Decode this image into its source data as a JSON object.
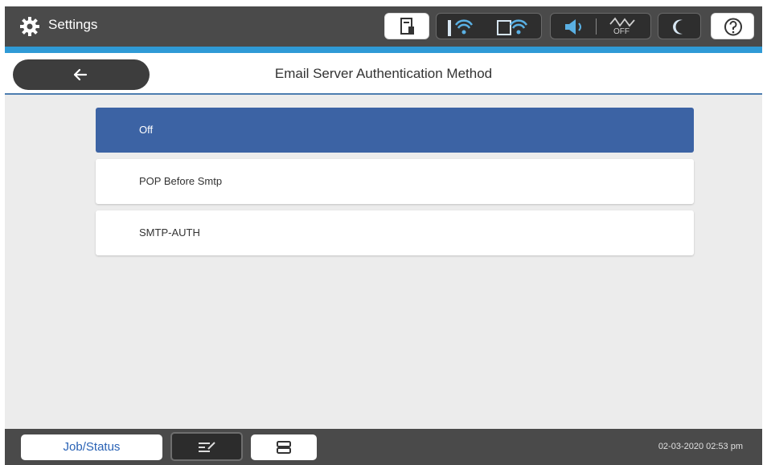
{
  "header": {
    "app_title": "Settings",
    "icons": [
      "gear-icon",
      "ink-levels-icon",
      "wifi-icon",
      "wifi-direct-icon",
      "sound-icon",
      "network-off-icon",
      "sleep-icon",
      "help-icon"
    ],
    "status_text": "OFF"
  },
  "titlebar": {
    "back_icon": "arrow-left-icon",
    "title": "Email Server Authentication Method"
  },
  "options": [
    {
      "label": "Off",
      "selected": true
    },
    {
      "label": "POP Before Smtp",
      "selected": false
    },
    {
      "label": "SMTP-AUTH",
      "selected": false
    }
  ],
  "footer": {
    "job_status_label": "Job/Status",
    "datetime": "02-03-2020 02:53 pm"
  },
  "colors": {
    "accent": "#2f9ad6",
    "selected": "#3c63a4",
    "bar": "#4a4a4a"
  }
}
